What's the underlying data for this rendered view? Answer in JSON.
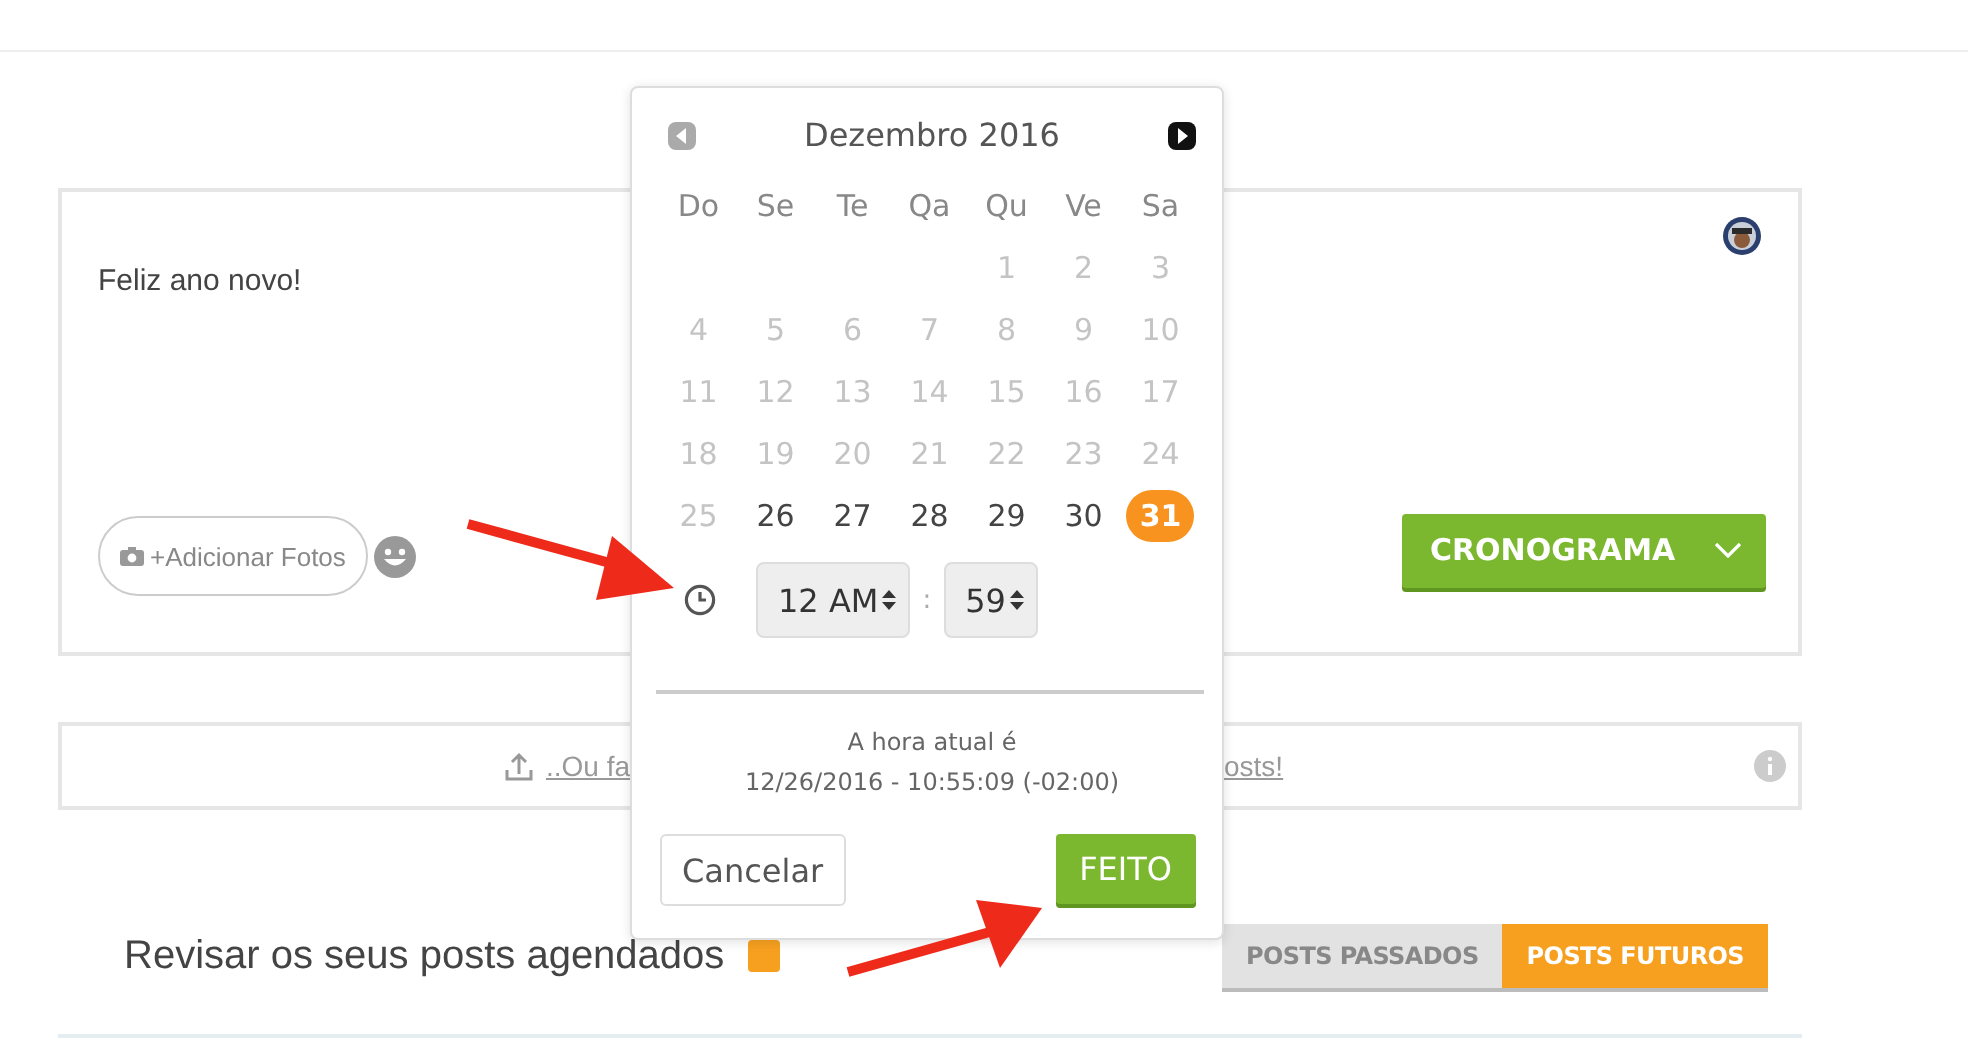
{
  "composer": {
    "text": "Feliz ano novo!",
    "add_photos": "+Adicionar Fotos",
    "schedule_button": "CRONOGRAMA"
  },
  "upload_bar": {
    "link_left": "..Ou fa",
    "link_right": "osts!"
  },
  "review": {
    "title": "Revisar os seus posts agendados",
    "tabs": [
      {
        "label": "POSTS PASSADOS",
        "selected": false
      },
      {
        "label": "POSTS FUTUROS",
        "selected": true
      }
    ]
  },
  "date_picker": {
    "month": "Dezembro 2016",
    "weekdays": [
      "Do",
      "Se",
      "Te",
      "Qa",
      "Qu",
      "Ve",
      "Sa"
    ],
    "weeks": [
      {
        "days": [
          {
            "label": "1",
            "disabled": true,
            "selected": false
          },
          {
            "label": "2",
            "disabled": true,
            "selected": false
          },
          {
            "label": "3",
            "disabled": true,
            "selected": false
          }
        ]
      },
      {
        "days": [
          {
            "label": "4",
            "disabled": true,
            "selected": false
          },
          {
            "label": "5",
            "disabled": true,
            "selected": false
          },
          {
            "label": "6",
            "disabled": true,
            "selected": false
          },
          {
            "label": "7",
            "disabled": true,
            "selected": false
          },
          {
            "label": "8",
            "disabled": true,
            "selected": false
          },
          {
            "label": "9",
            "disabled": true,
            "selected": false
          },
          {
            "label": "10",
            "disabled": true,
            "selected": false
          }
        ]
      },
      {
        "days": [
          {
            "label": "11",
            "disabled": true,
            "selected": false
          },
          {
            "label": "12",
            "disabled": true,
            "selected": false
          },
          {
            "label": "13",
            "disabled": true,
            "selected": false
          },
          {
            "label": "14",
            "disabled": true,
            "selected": false
          },
          {
            "label": "15",
            "disabled": true,
            "selected": false
          },
          {
            "label": "16",
            "disabled": true,
            "selected": false
          },
          {
            "label": "17",
            "disabled": true,
            "selected": false
          }
        ]
      },
      {
        "days": [
          {
            "label": "18",
            "disabled": true,
            "selected": false
          },
          {
            "label": "19",
            "disabled": true,
            "selected": false
          },
          {
            "label": "20",
            "disabled": true,
            "selected": false
          },
          {
            "label": "21",
            "disabled": true,
            "selected": false
          },
          {
            "label": "22",
            "disabled": true,
            "selected": false
          },
          {
            "label": "23",
            "disabled": true,
            "selected": false
          },
          {
            "label": "24",
            "disabled": true,
            "selected": false
          }
        ]
      },
      {
        "days": [
          {
            "label": "25",
            "disabled": true,
            "selected": false
          },
          {
            "label": "26",
            "disabled": false,
            "selected": false
          },
          {
            "label": "27",
            "disabled": false,
            "selected": false
          },
          {
            "label": "28",
            "disabled": false,
            "selected": false
          },
          {
            "label": "29",
            "disabled": false,
            "selected": false
          },
          {
            "label": "30",
            "disabled": false,
            "selected": false
          },
          {
            "label": "31",
            "disabled": false,
            "selected": true
          }
        ]
      }
    ],
    "hour": "12 AM",
    "separator": ":",
    "minute": "59",
    "current_time_label": "A hora atual é",
    "current_time": "12/26/2016 - 10:55:09 (-02:00)",
    "cancel_button": "Cancelar",
    "done_button": "FEITO"
  }
}
